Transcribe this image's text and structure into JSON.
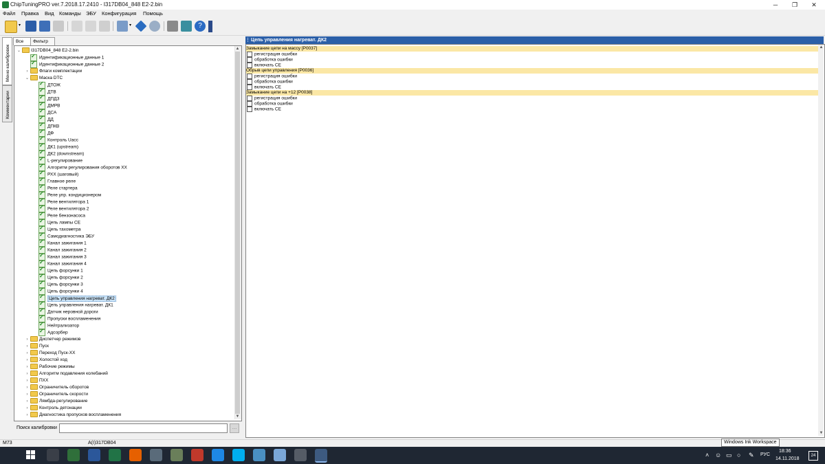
{
  "window": {
    "title": "ChipTuningPRO ver.7.2018.17.2410 - I317DB04_848 E2-2.bin",
    "minimize": "─",
    "maximize": "❐",
    "close": "✕"
  },
  "menu": {
    "items": [
      "Файл",
      "Правка",
      "Вид",
      "Команды",
      "ЭБУ",
      "Конфигурация",
      "Помощь"
    ]
  },
  "toolbar": {
    "icons": [
      "open-folder-icon",
      "dropdown-icon",
      "save-icon",
      "save-as-icon",
      "print-icon",
      "copy-icon",
      "paste-icon",
      "undo-icon",
      "checksum-icon",
      "dropdown-icon",
      "diamond-icon",
      "search-icon",
      "connect-icon",
      "flash-icon",
      "help-icon"
    ]
  },
  "side_tabs": {
    "calibration_menu": "Меню калибровок",
    "comments": "Комментарии"
  },
  "tree_tabs": {
    "all": "Все",
    "filter": "Фильтр"
  },
  "tree": {
    "root": "I317DB04_848 E2-2.bin",
    "top": [
      {
        "label": "Идентификационные данные 1",
        "type": "check"
      },
      {
        "label": "Идентификационные данные 2",
        "type": "check"
      },
      {
        "label": "Флаги комплектации",
        "type": "folder"
      },
      {
        "label": "Маска DTC",
        "type": "folder-open"
      }
    ],
    "dtc_children": [
      "ДТОЖ",
      "ДТВ",
      "ДПДЗ",
      "ДМРВ",
      "ДСА",
      "ДД",
      "ДПКВ",
      "ДФ",
      "Контроль Uacc",
      "ДК1 (upstream)",
      "ДК2 (downstream)",
      "L-регулирование",
      "Алгоритм регулирования оборотов ХХ",
      "РХХ (шаговый)",
      "Главное реле",
      "Реле стартера",
      "Реле упр. кондиционером",
      "Реле вентилятора 1",
      "Реле вентилятора 2",
      "Реле бензонасоса",
      "Цепь лампы CE",
      "Цепь тахометра",
      "Самодиагностика ЭБУ",
      "Канал зажигания 1",
      "Канал зажигания 2",
      "Канал зажигания 3",
      "Канал зажигания 4",
      "Цепь форсунки 1",
      "Цепь форсунки 2",
      "Цепь форсунки 3",
      "Цепь форсунки 4",
      "Цепь управления нагреват. ДК2",
      "Цепь управления нагреват. ДК1",
      "Датчик неровной дороги",
      "Пропуски воспламенения",
      "Нейтрализатор",
      "Адсорбер"
    ],
    "selected": "Цепь управления нагреват. ДК2",
    "folders": [
      "Диспетчер режимов",
      "Пуск",
      "Переход Пуск-ХХ",
      "Холостой ход",
      "Рабочие режимы",
      "Алгоритм подавления колебаний",
      "ПХХ",
      "Ограничитель оборотов",
      "Ограничитель скорости",
      "Лямбда-регулирование",
      "Контроль детонации",
      "Диагностика пропусков воспламенения"
    ]
  },
  "search": {
    "label": "Поиск калибровки",
    "value": "",
    "button": "…"
  },
  "panel": {
    "title": "Цепь управления нагреват. ДК2",
    "groups": [
      {
        "title": "Замыкание цепи на массу [P0037]",
        "options": [
          "регистрация ошибки",
          "обработка ошибки",
          "включать CE"
        ]
      },
      {
        "title": "Обрыв цепи управления [P0036]",
        "options": [
          "регистрация ошибки",
          "обработка ошибки",
          "включать CE"
        ]
      },
      {
        "title": "Замыкание цепи на +12 [P0038]",
        "options": [
          "регистрация ошибки",
          "обработка ошибки",
          "включать CE"
        ]
      }
    ]
  },
  "status": {
    "left": "M73",
    "middle": "A(I)317DB04",
    "tooltip": "Windows Ink Workspace"
  },
  "taskbar": {
    "icons": [
      "task-view-icon",
      "calculator-icon",
      "word-icon",
      "excel-icon",
      "firefox-icon",
      "app-icon",
      "app2-icon",
      "app3-icon",
      "edge-icon",
      "skype-icon",
      "app4-icon",
      "notepad-icon",
      "tanks-icon",
      "chiptuning-icon"
    ],
    "tray_up": "˄",
    "lang": "РУС",
    "time": "18:36",
    "date": "14.11.2018",
    "notifications": "24"
  },
  "colors": {
    "panel_header": "#2b5fa8",
    "group_header": "#fbe7a5",
    "taskbar": "#1f2733",
    "selected": "#cce4f7"
  }
}
